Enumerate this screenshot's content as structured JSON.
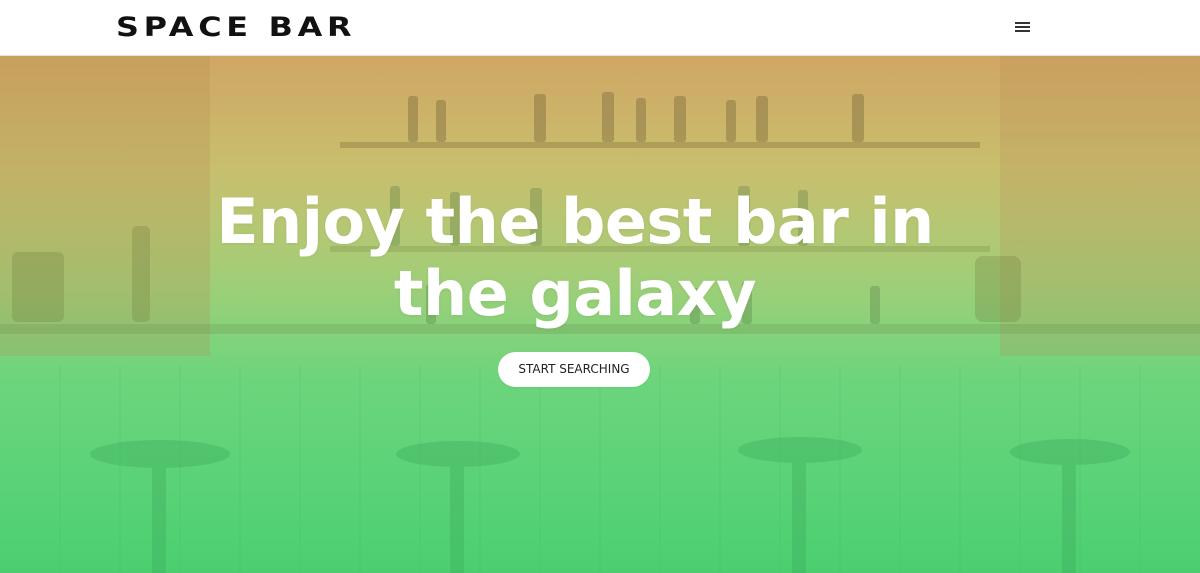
{
  "brand": {
    "name": "SPACE BAR"
  },
  "nav": {
    "menu_icon": "hamburger-menu-icon"
  },
  "hero": {
    "title": "Enjoy the best bar in the galaxy",
    "cta_label": "START SEARCHING"
  },
  "colors": {
    "brand_text": "#111111",
    "overlay_top": "#d9b46c",
    "overlay_bottom": "#55d177",
    "cta_background": "#ffffff"
  }
}
